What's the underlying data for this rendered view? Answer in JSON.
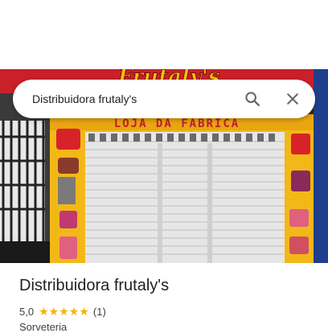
{
  "search": {
    "query": "Distribuidora frutaly's"
  },
  "photo": {
    "sign_text": "LOJA DA FABRICA",
    "logo_text": "Frutaly's"
  },
  "place": {
    "name": "Distribuidora frutaly's",
    "rating": "5,0",
    "stars": 5,
    "review_count": "(1)",
    "category": "Sorveteria"
  },
  "colors": {
    "star": "#f5b400",
    "sign_yellow": "#f2b818",
    "sign_red": "#d8222a"
  },
  "icons": [
    "search-icon",
    "close-icon",
    "star-icon"
  ]
}
